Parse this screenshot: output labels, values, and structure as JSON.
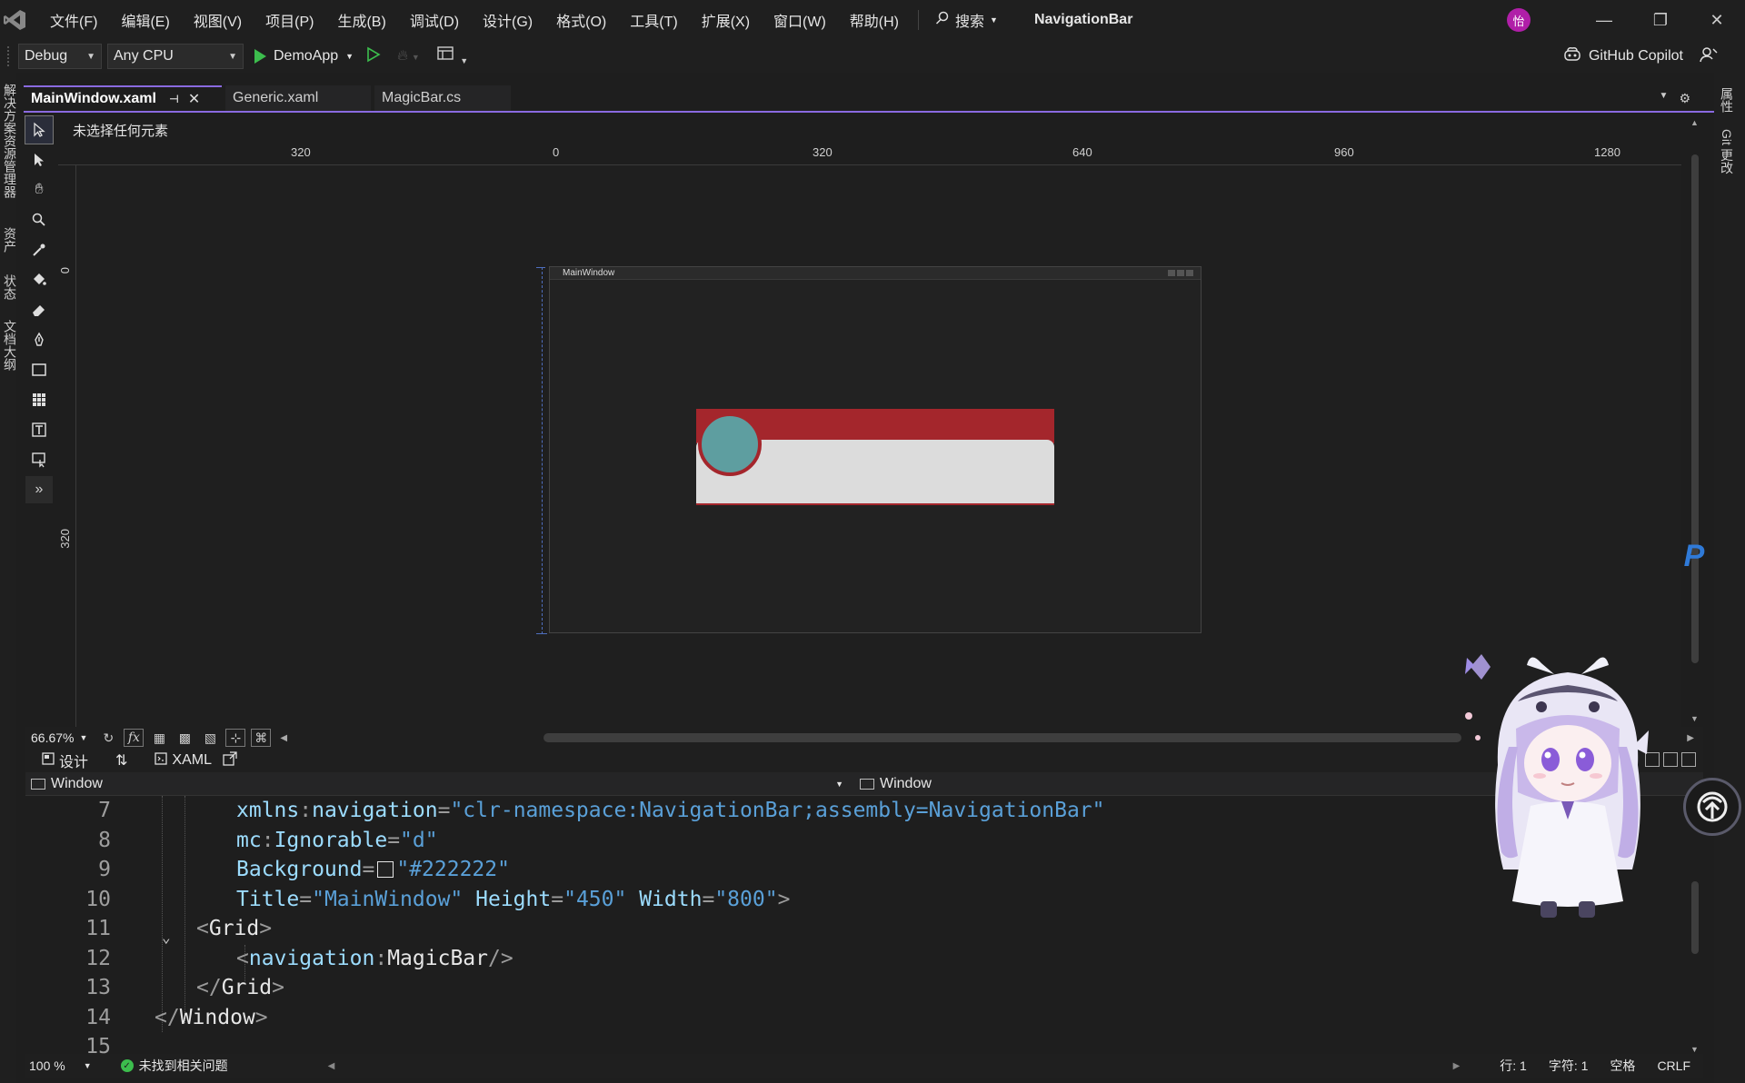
{
  "menu": {
    "items": [
      "文件(F)",
      "编辑(E)",
      "视图(V)",
      "项目(P)",
      "生成(B)",
      "调试(D)",
      "设计(G)",
      "格式(O)",
      "工具(T)",
      "扩展(X)",
      "窗口(W)",
      "帮助(H)"
    ],
    "search_label": "搜索",
    "solution_name": "NavigationBar",
    "avatar_initial": "怡"
  },
  "toolbar": {
    "config": "Debug",
    "platform": "Any CPU",
    "run_target": "DemoApp",
    "copilot_label": "GitHub Copilot"
  },
  "left_tabs": [
    "解决方案资源管理器",
    "资产",
    "状态",
    "文档大纲"
  ],
  "right_tabs": [
    "属性",
    "Git 更改"
  ],
  "doc_tabs": [
    {
      "label": "MainWindow.xaml",
      "active": true
    },
    {
      "label": "Generic.xaml",
      "active": false
    },
    {
      "label": "MagicBar.cs",
      "active": false
    }
  ],
  "designer": {
    "selection_label": "未选择任何元素",
    "ruler_h": [
      "320",
      "0",
      "320",
      "640",
      "960",
      "1280"
    ],
    "ruler_v": [
      "0",
      "320"
    ],
    "preview_title": "MainWindow",
    "zoom": "66.67%"
  },
  "split": {
    "design_label": "设计",
    "xaml_label": "XAML"
  },
  "nav": {
    "left": "Window",
    "right": "Window"
  },
  "code_lines": [
    {
      "n": "7",
      "tokens": [
        [
          "attr",
          "xmlns"
        ],
        [
          "punc",
          ":"
        ],
        [
          "attr",
          "navigation"
        ],
        [
          "punc",
          "="
        ],
        [
          "str",
          "\"clr-namespace:NavigationBar;assembly=NavigationBar\""
        ]
      ]
    },
    {
      "n": "8",
      "tokens": [
        [
          "attr",
          "mc"
        ],
        [
          "punc",
          ":"
        ],
        [
          "attr",
          "Ignorable"
        ],
        [
          "punc",
          "="
        ],
        [
          "str",
          "\"d\""
        ]
      ]
    },
    {
      "n": "9",
      "tokens": [
        [
          "attr",
          "Background"
        ],
        [
          "punc",
          "="
        ],
        [
          "swatch",
          ""
        ],
        [
          "str",
          "\"#222222\""
        ]
      ]
    },
    {
      "n": "10",
      "tokens": [
        [
          "attr",
          "Title"
        ],
        [
          "punc",
          "="
        ],
        [
          "str",
          "\"MainWindow\""
        ],
        [
          "tag",
          " "
        ],
        [
          "attr",
          "Height"
        ],
        [
          "punc",
          "="
        ],
        [
          "str",
          "\"450\""
        ],
        [
          "tag",
          " "
        ],
        [
          "attr",
          "Width"
        ],
        [
          "punc",
          "="
        ],
        [
          "str",
          "\"800\""
        ],
        [
          "punc",
          ">"
        ]
      ]
    },
    {
      "n": "11",
      "tokens": [
        [
          "punc",
          "<"
        ],
        [
          "tag",
          "Grid"
        ],
        [
          "punc",
          ">"
        ]
      ]
    },
    {
      "n": "12",
      "tokens": [
        [
          "punc",
          "<"
        ],
        [
          "ns",
          "navigation"
        ],
        [
          "punc",
          ":"
        ],
        [
          "tag",
          "MagicBar"
        ],
        [
          "punc",
          "/>"
        ]
      ]
    },
    {
      "n": "13",
      "tokens": [
        [
          "punc",
          "</"
        ],
        [
          "tag",
          "Grid"
        ],
        [
          "punc",
          ">"
        ]
      ]
    },
    {
      "n": "14",
      "tokens": [
        [
          "punc",
          "</"
        ],
        [
          "tag",
          "Window"
        ],
        [
          "punc",
          ">"
        ]
      ]
    },
    {
      "n": "15",
      "tokens": []
    }
  ],
  "status": {
    "zoom": "100 %",
    "issues": "未找到相关问题",
    "line": "行: 1",
    "char": "字符: 1",
    "whitespace": "空格",
    "eol": "CRLF"
  },
  "colors": {
    "accent": "#8a6ae0",
    "magicbar_red": "#a4262c",
    "magicbar_body": "#dcdcdc",
    "magicbar_circle": "#5e9ea0",
    "window_bg": "#222222"
  }
}
